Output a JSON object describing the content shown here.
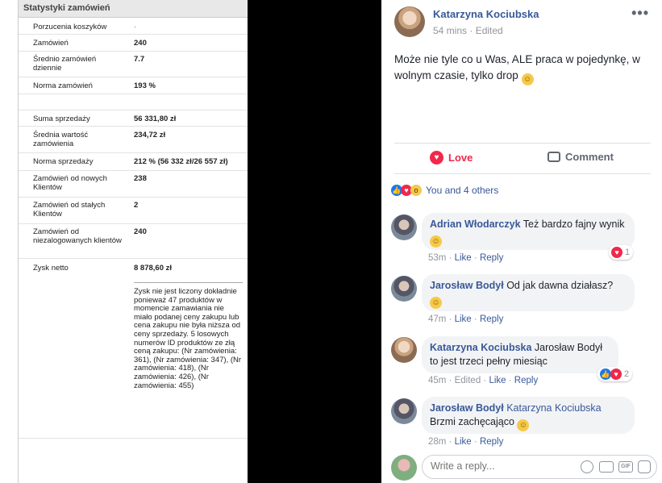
{
  "stats": {
    "title": "Statystyki zamówień",
    "rows": [
      {
        "label": "Porzucenia koszyków",
        "value": "-"
      },
      {
        "label": "Zamówień",
        "value": "240"
      },
      {
        "label": "Średnio zamówień dziennie",
        "value": "7.7"
      },
      {
        "label": "Norma zamówień",
        "value": "193 %"
      },
      {
        "label": "",
        "value": ""
      },
      {
        "label": "Suma sprzedaży",
        "value": "56 331,80 zł"
      },
      {
        "label": "Średnia wartość zamówienia",
        "value": "234,72 zł"
      },
      {
        "label": "Norma sprzedaży",
        "value": "212 % (56 332 zł/26 557 zł)"
      },
      {
        "label": "Zamówień od nowych Klientów",
        "value": "238"
      },
      {
        "label": "Zamówień od stałych Klientów",
        "value": "2"
      },
      {
        "label": "Zamówień od niezalogowanych klientów",
        "value": "240"
      },
      {
        "label": "Zysk netto",
        "value": "8 878,60 zł"
      }
    ],
    "note": "Zysk nie jest liczony dokładnie ponieważ 47 produktów w momencie zamawiania nie miało podanej ceny zakupu lub cena zakupu nie była niższa od ceny sprzedaży. 5 losowych numerów ID produktów ze złą ceną zakupu: (Nr zamówienia: 361), (Nr zamówienia: 347), (Nr zamówienia: 418), (Nr zamówienia: 426), (Nr zamówienia: 455)"
  },
  "post": {
    "author": "Katarzyna Kociubska",
    "time": "54 mins",
    "edited": "Edited",
    "body": "Może nie tyle co u Was, ALE praca w pojedynkę, w wolnym czasie, tylko drop",
    "more_icon": "more-dots-icon",
    "love_label": "Love",
    "comment_label": "Comment",
    "reactions_text": "You and 4 others",
    "colors": {
      "link": "#385898",
      "love": "#f0284a",
      "like": "#1877f2",
      "black_panel": "#000000"
    }
  },
  "comments": [
    {
      "author": "Adrian Włodarczyk",
      "text": "Też bardzo fajny wynik",
      "time": "53m",
      "like": "Like",
      "reply": "Reply",
      "reactions": "1",
      "reaction_type": "heart"
    },
    {
      "author": "Jarosław Bodył",
      "text": "Od jak dawna działasz?",
      "time": "47m",
      "like": "Like",
      "reply": "Reply"
    },
    {
      "author": "Katarzyna Kociubska",
      "text": "Jarosław Bodył to jest trzeci pełny miesiąc",
      "time": "45m",
      "edited": "Edited",
      "like": "Like",
      "reply": "Reply",
      "reactions": "2",
      "reaction_type": "like-heart"
    },
    {
      "author": "Jarosław Bodył",
      "mention": "Katarzyna Kociubska",
      "text": "Brzmi zachęcająco",
      "time": "28m",
      "like": "Like",
      "reply": "Reply"
    }
  ],
  "composer": {
    "placeholder": "Write a reply...",
    "icons": [
      "emoji-icon",
      "camera-icon",
      "gif-icon",
      "sticker-icon"
    ]
  }
}
